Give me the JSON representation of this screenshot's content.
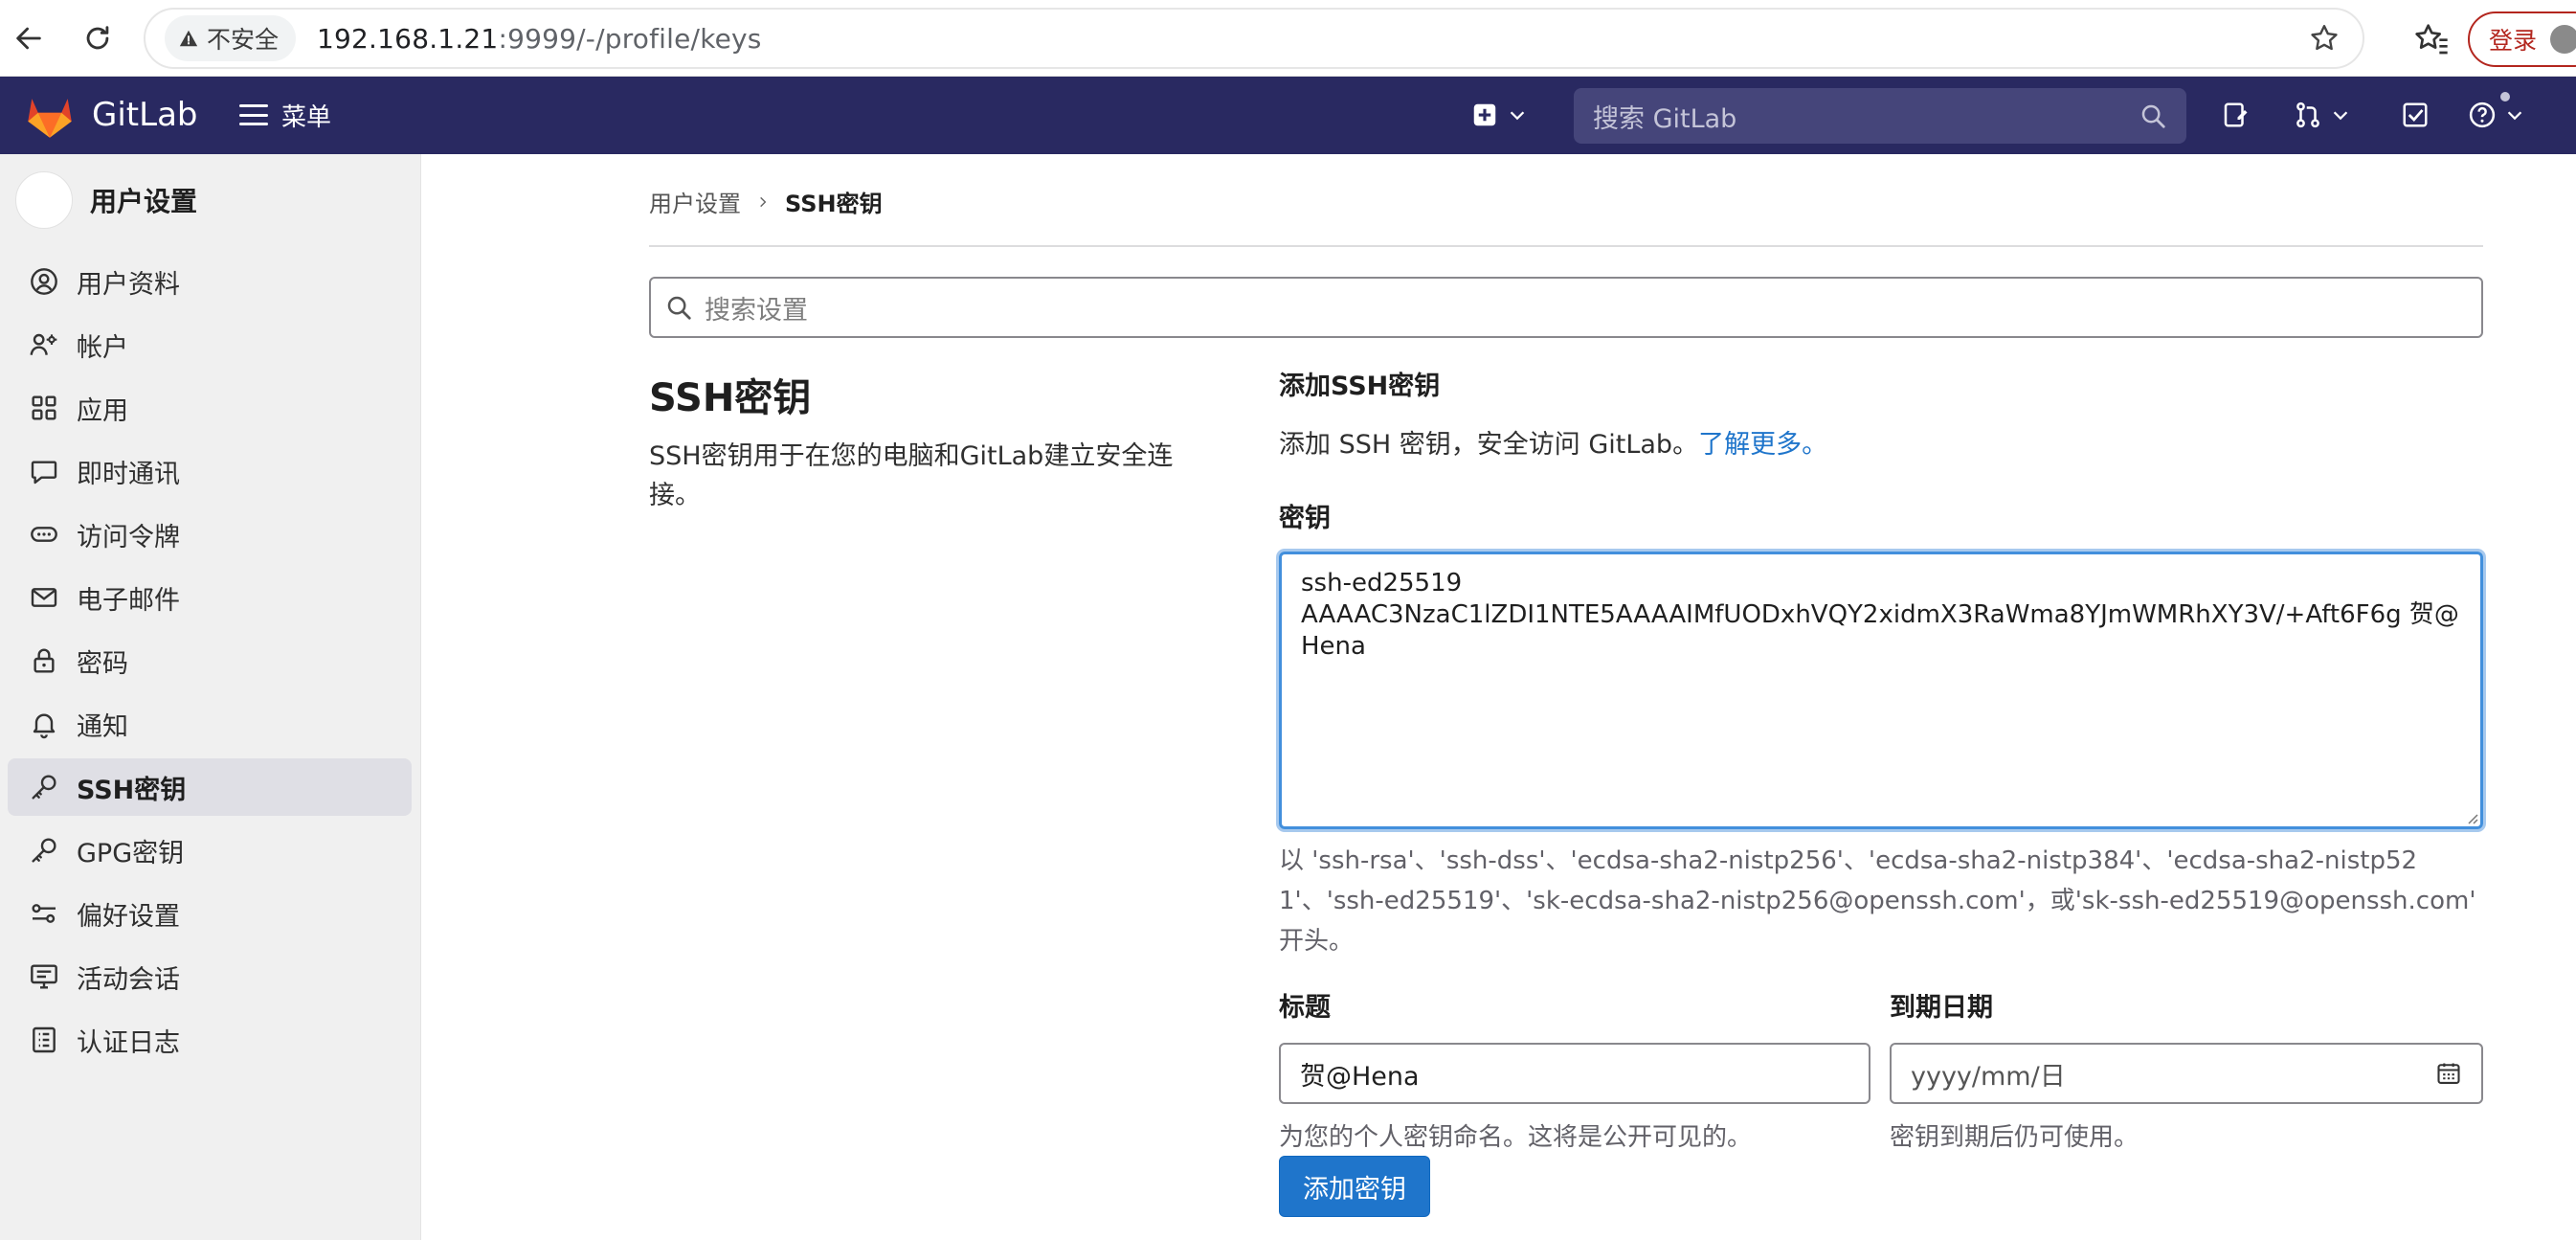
{
  "browser": {
    "insecure_label": "不安全",
    "url_host": "192.168.1.21",
    "url_rest": ":9999/-/profile/keys",
    "login_label": "登录"
  },
  "header": {
    "brand": "GitLab",
    "menu_label": "菜单",
    "search_placeholder": "搜索 GitLab",
    "colors": {
      "bg": "#292961",
      "search_bg": "#45457a"
    }
  },
  "sidebar": {
    "title": "用户设置",
    "items": [
      {
        "label": "用户资料",
        "icon": "user-icon"
      },
      {
        "label": "帐户",
        "icon": "account-icon"
      },
      {
        "label": "应用",
        "icon": "applications-icon"
      },
      {
        "label": "即时通讯",
        "icon": "chat-icon"
      },
      {
        "label": "访问令牌",
        "icon": "token-icon"
      },
      {
        "label": "电子邮件",
        "icon": "mail-icon"
      },
      {
        "label": "密码",
        "icon": "lock-icon"
      },
      {
        "label": "通知",
        "icon": "notifications-icon"
      },
      {
        "label": "SSH密钥",
        "icon": "key-icon",
        "active": true
      },
      {
        "label": "GPG密钥",
        "icon": "key-icon"
      },
      {
        "label": "偏好设置",
        "icon": "preferences-icon"
      },
      {
        "label": "活动会话",
        "icon": "monitor-icon"
      },
      {
        "label": "认证日志",
        "icon": "log-icon"
      }
    ]
  },
  "breadcrumb": {
    "parent": "用户设置",
    "current": "SSH密钥"
  },
  "settings_search": {
    "placeholder": "搜索设置"
  },
  "section": {
    "title": "SSH密钥",
    "description": "SSH密钥用于在您的电脑和GitLab建立安全连接。"
  },
  "form": {
    "heading": "添加SSH密钥",
    "intro": "添加 SSH 密钥，安全访问 GitLab。",
    "learn_more": "了解更多。",
    "key_label": "密钥",
    "key_value": "ssh-ed25519\nAAAAC3NzaC1lZDI1NTE5AAAAIMfUODxhVQY2xidmX3RaWma8YJmWMRhXY3V/+Aft6F6g 贺@Hena",
    "key_help": "以 'ssh-rsa'、'ssh-dss'、'ecdsa-sha2-nistp256'、'ecdsa-sha2-nistp384'、'ecdsa-sha2-nistp521'、'ssh-ed25519'、'sk-ecdsa-sha2-nistp256@openssh.com'，或'sk-ssh-ed25519@openssh.com' 开头。",
    "title_label": "标题",
    "title_value": "贺@Hena",
    "title_hint": "为您的个人密钥命名。这将是公开可见的。",
    "expiry_label": "到期日期",
    "expiry_placeholder": "yyyy/mm/日",
    "expiry_hint": "密钥到期后仍可使用。",
    "submit_label": "添加密钥",
    "colors": {
      "primary": "#1f75cb",
      "link": "#1f75cb",
      "focus": "#428fdc"
    }
  }
}
